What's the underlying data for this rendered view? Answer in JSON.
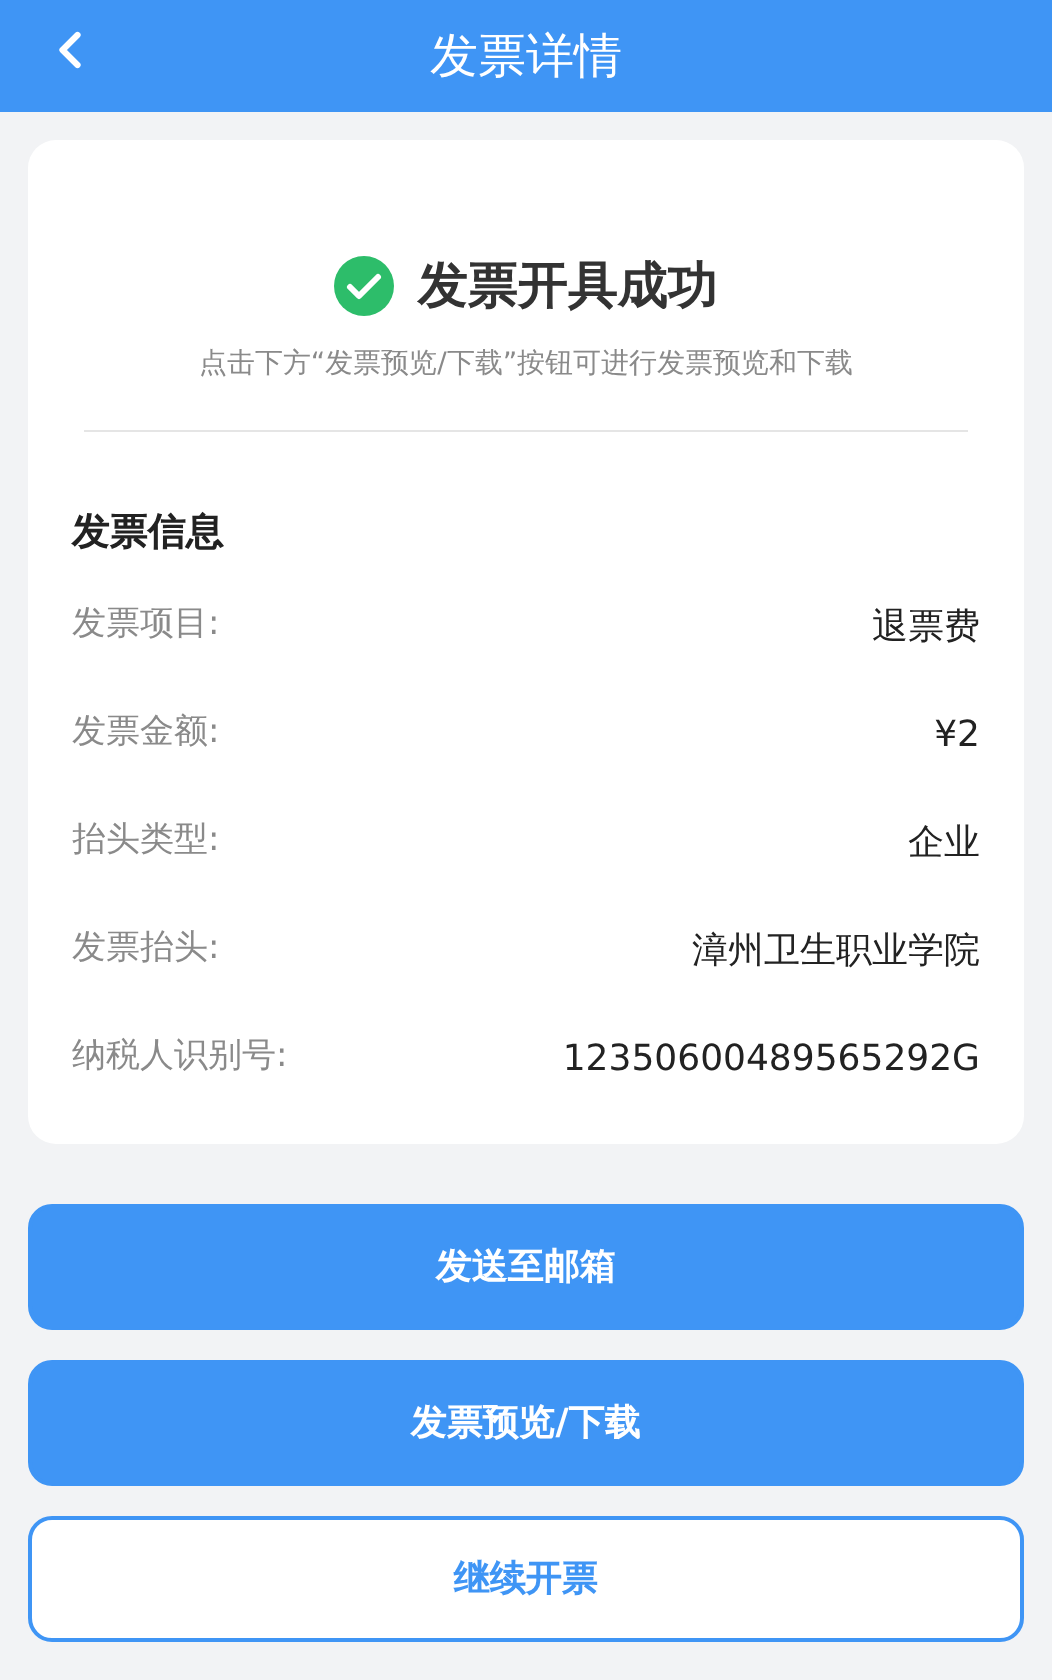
{
  "header": {
    "title": "发票详情"
  },
  "status": {
    "title": "发票开具成功",
    "hint": "点击下方“发票预览/下载”按钮可进行发票预览和下载"
  },
  "info": {
    "heading": "发票信息",
    "rows": [
      {
        "label": "发票项目:",
        "value": "退票费"
      },
      {
        "label": "发票金额:",
        "value": "¥2"
      },
      {
        "label": "抬头类型:",
        "value": "企业"
      },
      {
        "label": "发票抬头:",
        "value": "漳州卫生职业学院"
      },
      {
        "label": "纳税人识别号:",
        "value": "12350600489565292G"
      }
    ]
  },
  "buttons": [
    {
      "label": "发送至邮箱",
      "kind": "primary"
    },
    {
      "label": "发票预览/下载",
      "kind": "primary"
    },
    {
      "label": "继续开票",
      "kind": "outline"
    }
  ]
}
